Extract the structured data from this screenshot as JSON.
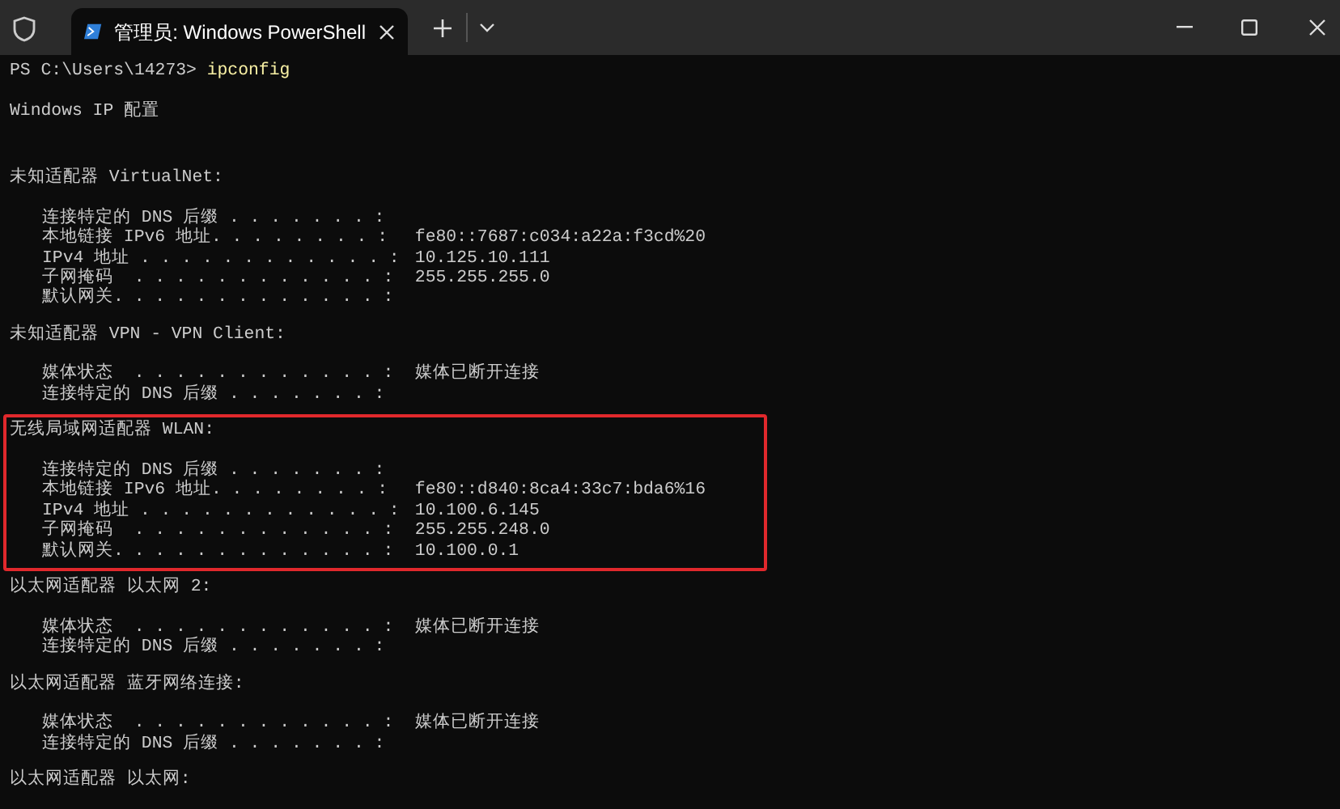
{
  "window": {
    "tab": {
      "title": "管理员: Windows PowerShell",
      "selected": true
    }
  },
  "terminal": {
    "prompt": "PS C:\\Users\\14273> ",
    "command": "ipconfig",
    "header": "Windows IP 配置",
    "adapters": [
      {
        "title": "未知适配器 VirtualNet:",
        "highlighted": false,
        "entries": [
          {
            "label": "连接特定的 DNS 后缀 . . . . . . . :"
          },
          {
            "label": "本地链接 IPv6 地址. . . . . . . . :",
            "value": "fe80::7687:c034:a22a:f3cd%20"
          },
          {
            "label": "IPv4 地址 . . . . . . . . . . . . :",
            "value": "10.125.10.111"
          },
          {
            "label": "子网掩码  . . . . . . . . . . . . :",
            "value": "255.255.255.0"
          },
          {
            "label": "默认网关. . . . . . . . . . . . . :"
          }
        ]
      },
      {
        "title": "未知适配器 VPN - VPN Client:",
        "highlighted": false,
        "entries": [
          {
            "label": "媒体状态  . . . . . . . . . . . . :",
            "value": "媒体已断开连接"
          },
          {
            "label": "连接特定的 DNS 后缀 . . . . . . . :"
          }
        ]
      },
      {
        "title": "无线局域网适配器 WLAN:",
        "highlighted": true,
        "entries": [
          {
            "label": "连接特定的 DNS 后缀 . . . . . . . :"
          },
          {
            "label": "本地链接 IPv6 地址. . . . . . . . :",
            "value": "fe80::d840:8ca4:33c7:bda6%16"
          },
          {
            "label": "IPv4 地址 . . . . . . . . . . . . :",
            "value": "10.100.6.145"
          },
          {
            "label": "子网掩码  . . . . . . . . . . . . :",
            "value": "255.255.248.0"
          },
          {
            "label": "默认网关. . . . . . . . . . . . . :",
            "value": "10.100.0.1"
          }
        ]
      },
      {
        "title": "以太网适配器 以太网 2:",
        "highlighted": false,
        "entries": [
          {
            "label": "媒体状态  . . . . . . . . . . . . :",
            "value": "媒体已断开连接"
          },
          {
            "label": "连接特定的 DNS 后缀 . . . . . . . :"
          }
        ]
      },
      {
        "title": "以太网适配器 蓝牙网络连接:",
        "highlighted": false,
        "entries": [
          {
            "label": "媒体状态  . . . . . . . . . . . . :",
            "value": "媒体已断开连接"
          },
          {
            "label": "连接特定的 DNS 后缀 . . . . . . . :"
          }
        ]
      },
      {
        "title": "以太网适配器 以太网:",
        "highlighted": false
      }
    ]
  }
}
